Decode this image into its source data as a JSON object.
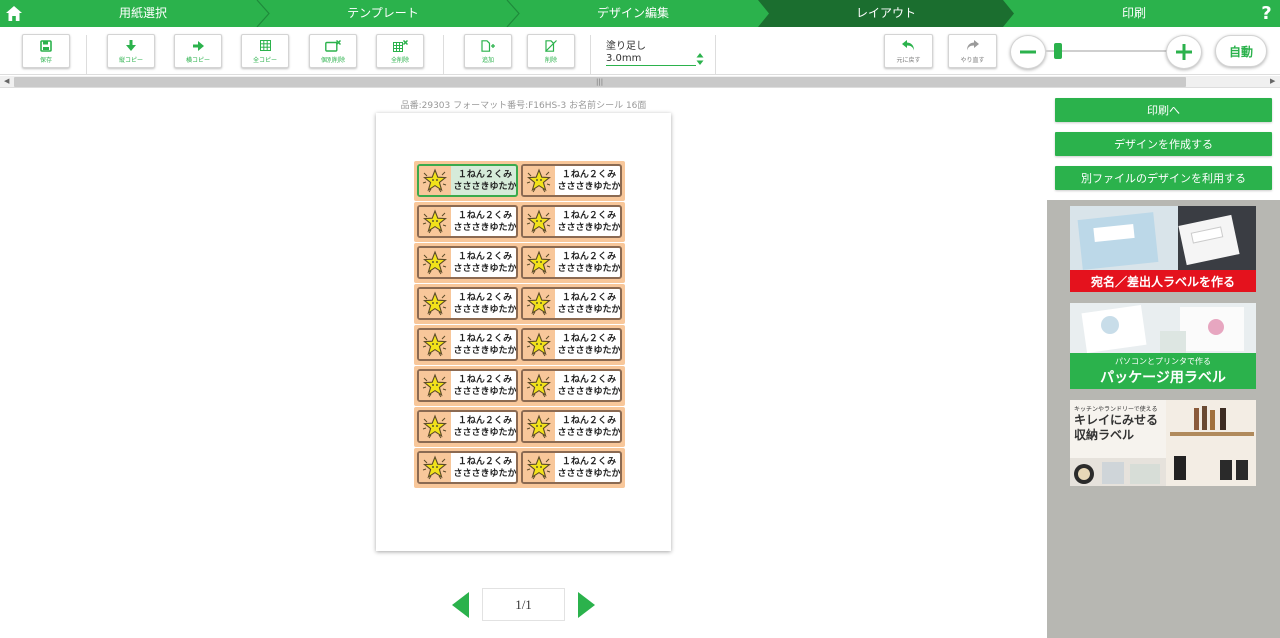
{
  "steps": [
    "用紙選択",
    "テンプレート",
    "デザイン編集",
    "レイアウト",
    "印刷"
  ],
  "active_step": "レイアウト",
  "help_label": "?",
  "toolbar": {
    "save": "保存",
    "copy_vertical": "縦コピー",
    "copy_horizontal": "横コピー",
    "copy_all": "全コピー",
    "delete_individual": "個別削除",
    "delete_all": "全削除",
    "add": "追加",
    "delete": "削除",
    "bleed_label": "塗り足し",
    "bleed_value": "3.0mm",
    "undo": "元に戻す",
    "redo": "やり直す",
    "auto": "自動"
  },
  "product_info": "品番:29303 フォーマット番号:F16HS-3 お名前シール 16面",
  "label_text": {
    "line1": "１ねん２くみ",
    "line2": "さささきゆたか"
  },
  "pagination": {
    "indicator": "1/1"
  },
  "right_panel": {
    "print_button": "印刷へ",
    "create_design_button": "デザインを作成する",
    "use_other_file_button": "別ファイルのデザインを利用する",
    "ads": {
      "ad1": "宛名／差出人ラベルを作る",
      "ad2_small": "パソコンとプリンタで作る",
      "ad2_big": "パッケージ用ラベル",
      "ad3_small": "キッチンやランドリーで使える",
      "ad3_line1": "キレイにみせる",
      "ad3_line2": "収納ラベル"
    }
  },
  "colors": {
    "brand_green": "#2bb24c",
    "active_step": "#1b6e2f",
    "label_orange": "#f8c79a",
    "label_border": "#8b6a52",
    "ad_red": "#e4121d"
  }
}
